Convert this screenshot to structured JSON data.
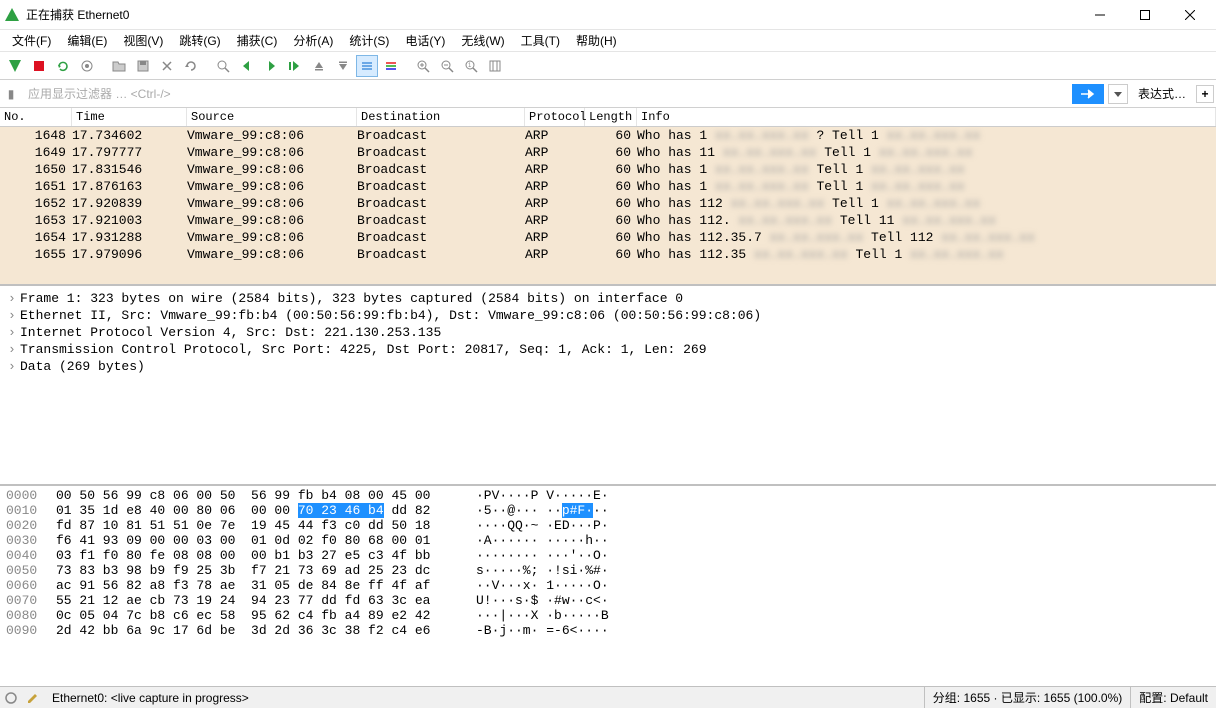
{
  "window": {
    "title": "正在捕获 Ethernet0"
  },
  "menu": [
    "文件(F)",
    "编辑(E)",
    "视图(V)",
    "跳转(G)",
    "捕获(C)",
    "分析(A)",
    "统计(S)",
    "电话(Y)",
    "无线(W)",
    "工具(T)",
    "帮助(H)"
  ],
  "filter": {
    "placeholder": "应用显示过滤器 … <Ctrl-/>",
    "expr_label": "表达式…"
  },
  "columns": {
    "no": "No.",
    "time": "Time",
    "src": "Source",
    "dst": "Destination",
    "proto": "Protocol",
    "len": "Length",
    "info": "Info"
  },
  "packets": [
    {
      "no": "1648",
      "time": "17.734602",
      "src": "Vmware_99:c8:06",
      "dst": "Broadcast",
      "proto": "ARP",
      "len": "60",
      "info_a": "Who has 1",
      "info_b": "? Tell 1"
    },
    {
      "no": "1649",
      "time": "17.797777",
      "src": "Vmware_99:c8:06",
      "dst": "Broadcast",
      "proto": "ARP",
      "len": "60",
      "info_a": "Who has 11",
      "info_b": "Tell 1"
    },
    {
      "no": "1650",
      "time": "17.831546",
      "src": "Vmware_99:c8:06",
      "dst": "Broadcast",
      "proto": "ARP",
      "len": "60",
      "info_a": "Who has 1",
      "info_b": "Tell 1"
    },
    {
      "no": "1651",
      "time": "17.876163",
      "src": "Vmware_99:c8:06",
      "dst": "Broadcast",
      "proto": "ARP",
      "len": "60",
      "info_a": "Who has 1",
      "info_b": "Tell 1"
    },
    {
      "no": "1652",
      "time": "17.920839",
      "src": "Vmware_99:c8:06",
      "dst": "Broadcast",
      "proto": "ARP",
      "len": "60",
      "info_a": "Who has 112",
      "info_b": "Tell 1"
    },
    {
      "no": "1653",
      "time": "17.921003",
      "src": "Vmware_99:c8:06",
      "dst": "Broadcast",
      "proto": "ARP",
      "len": "60",
      "info_a": "Who has 112.",
      "info_b": "Tell 11"
    },
    {
      "no": "1654",
      "time": "17.931288",
      "src": "Vmware_99:c8:06",
      "dst": "Broadcast",
      "proto": "ARP",
      "len": "60",
      "info_a": "Who has 112.35.7",
      "info_b": "Tell 112"
    },
    {
      "no": "1655",
      "time": "17.979096",
      "src": "Vmware_99:c8:06",
      "dst": "Broadcast",
      "proto": "ARP",
      "len": "60",
      "info_a": "Who has 112.35",
      "info_b": "Tell 1"
    }
  ],
  "details": [
    "Frame 1: 323 bytes on wire (2584 bits), 323 bytes captured (2584 bits) on interface 0",
    "Ethernet II, Src: Vmware_99:fb:b4 (00:50:56:99:fb:b4), Dst: Vmware_99:c8:06 (00:50:56:99:c8:06)",
    "Internet Protocol Version 4, Src:              Dst: 221.130.253.135",
    "Transmission Control Protocol, Src Port: 4225, Dst Port: 20817, Seq: 1, Ack: 1, Len: 269",
    "Data (269 bytes)"
  ],
  "hex": [
    {
      "off": "0000",
      "h": "00 50 56 99 c8 06 00 50  56 99 fb b4 08 00 45 00",
      "a": "·PV····P V·····E·"
    },
    {
      "off": "0010",
      "h1": "01 35 1d e8 40 00 80 06  00 00 ",
      "hl": "70 23 46 b4",
      "h2": " dd 82",
      "a1": "·5··@··· ··",
      "al": "p#F·",
      "a2": "··"
    },
    {
      "off": "0020",
      "h": "fd 87 10 81 51 51 0e 7e  19 45 44 f3 c0 dd 50 18",
      "a": "····QQ·~ ·ED···P·"
    },
    {
      "off": "0030",
      "h": "f6 41 93 09 00 00 03 00  01 0d 02 f0 80 68 00 01",
      "a": "·A······ ·····h··"
    },
    {
      "off": "0040",
      "h": "03 f1 f0 80 fe 08 08 00  00 b1 b3 27 e5 c3 4f bb",
      "a": "········ ···'··O·"
    },
    {
      "off": "0050",
      "h": "73 83 b3 98 b9 f9 25 3b  f7 21 73 69 ad 25 23 dc",
      "a": "s·····%; ·!si·%#·"
    },
    {
      "off": "0060",
      "h": "ac 91 56 82 a8 f3 78 ae  31 05 de 84 8e ff 4f af",
      "a": "··V···x· 1·····O·"
    },
    {
      "off": "0070",
      "h": "55 21 12 ae cb 73 19 24  94 23 77 dd fd 63 3c ea",
      "a": "U!···s·$ ·#w··c<·"
    },
    {
      "off": "0080",
      "h": "0c 05 04 7c b8 c6 ec 58  95 62 c4 fb a4 89 e2 42",
      "a": "···|···X ·b·····B"
    },
    {
      "off": "0090",
      "h": "2d 42 bb 6a 9c 17 6d be  3d 2d 36 3c 38 f2 c4 e6",
      "a": "-B·j··m· =-6<····"
    }
  ],
  "status": {
    "iface": "Ethernet0:",
    "capture": "<live capture in progress>",
    "pkts_label": "分组:",
    "pkts": "1655",
    "disp_label": "已显示:",
    "disp": "1655 (100.0%)",
    "profile_label": "配置:",
    "profile": "Default"
  }
}
